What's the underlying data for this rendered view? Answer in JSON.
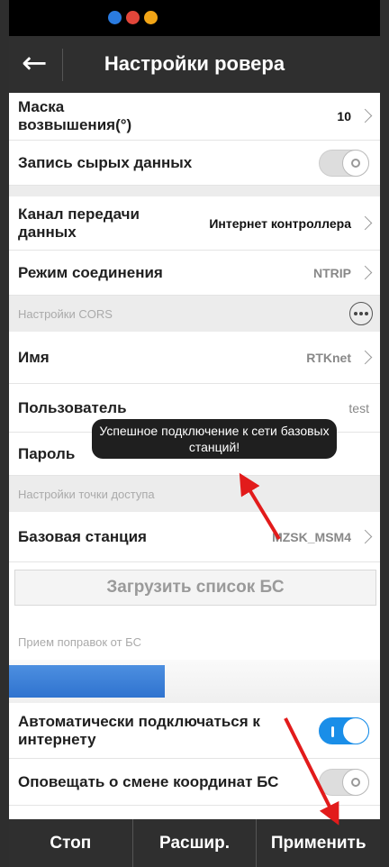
{
  "header": {
    "title": "Настройки ровера"
  },
  "rows": {
    "elevation_mask": {
      "label": "Маска возвышения(°)",
      "value": "10"
    },
    "raw_data": {
      "label": "Запись сырых данных"
    },
    "data_channel": {
      "label": "Канал передачи данных",
      "value": "Интернет контроллера"
    },
    "connection_mode": {
      "label": "Режим соединения",
      "value": "NTRIP"
    },
    "name": {
      "label": "Имя",
      "value": "RTKnet"
    },
    "user": {
      "label": "Пользователь",
      "value": "test"
    },
    "password": {
      "label": "Пароль"
    },
    "base_station": {
      "label": "Базовая станция",
      "value": "MZSK_MSM4"
    },
    "auto_connect": {
      "label": "Автоматически подключаться к интернету"
    },
    "notify_coords": {
      "label": "Оповещать о смене координат БС"
    }
  },
  "sections": {
    "cors": "Настройки CORS",
    "access_point": "Настройки точки доступа",
    "corrections": "Прием поправок от БС"
  },
  "load_list_button": "Загрузить список БС",
  "toast": "Успешное подключение к сети базовых станций!",
  "corrections_progress": 0.42,
  "toggles": {
    "raw_data": false,
    "auto_connect": true,
    "notify_coords": false
  },
  "bottom": {
    "stop": "Стоп",
    "advanced": "Расшир.",
    "apply": "Применить"
  },
  "colors": {
    "accent_blue": "#1a8ee8",
    "bar_dark": "#2f2f2f",
    "arrow_red": "#e21b1b"
  },
  "icons": {
    "back": "arrow-left-icon",
    "more": "more-horizontal-icon",
    "chevron": "chevron-right-icon"
  }
}
